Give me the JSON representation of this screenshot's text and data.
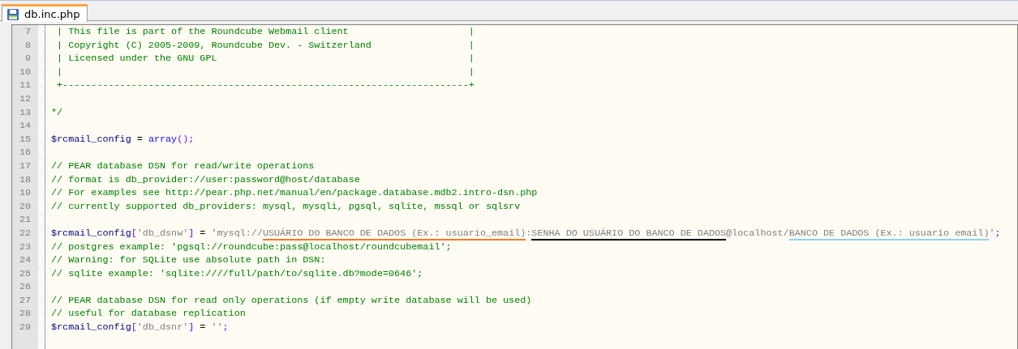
{
  "tabs": [
    {
      "label": "db.inc.php",
      "selected": true
    }
  ],
  "editor": {
    "lines": [
      {
        "number": "7",
        "tokens": [
          {
            "kind": "comment",
            "text": " | This file is part of the Roundcube Webmail client                     |"
          }
        ]
      },
      {
        "number": "8",
        "tokens": [
          {
            "kind": "comment",
            "text": " | Copyright (C) 2005-2009, Roundcube Dev. - Switzerland                 |"
          }
        ]
      },
      {
        "number": "9",
        "tokens": [
          {
            "kind": "comment",
            "text": " | Licensed under the GNU GPL                                            |"
          }
        ]
      },
      {
        "number": "10",
        "tokens": [
          {
            "kind": "comment",
            "text": " |                                                                       |"
          }
        ]
      },
      {
        "number": "11",
        "tokens": [
          {
            "kind": "comment",
            "text": " +-----------------------------------------------------------------------+"
          }
        ]
      },
      {
        "number": "12"
      },
      {
        "number": "13",
        "tokens": [
          {
            "kind": "comment",
            "text": "*/"
          }
        ]
      },
      {
        "number": "14"
      },
      {
        "number": "15",
        "tokens": [
          {
            "kind": "variable",
            "text": "$rcmail_config"
          },
          {
            "kind": "plain",
            "text": " = "
          },
          {
            "kind": "keyword",
            "text": "array"
          },
          {
            "kind": "operator",
            "text": "();"
          }
        ]
      },
      {
        "number": "16"
      },
      {
        "number": "17",
        "tokens": [
          {
            "kind": "comment",
            "text": "// PEAR database DSN for read/write operations"
          }
        ]
      },
      {
        "number": "18",
        "tokens": [
          {
            "kind": "comment",
            "text": "// format is db_provider://user:password@host/database"
          }
        ]
      },
      {
        "number": "19",
        "tokens": [
          {
            "kind": "comment",
            "text": "// For examples see http://pear.php.net/manual/en/package.database.mdb2.intro-dsn.php"
          }
        ]
      },
      {
        "number": "20",
        "tokens": [
          {
            "kind": "comment",
            "text": "// currently supported db_providers: mysql, mysqli, pgsql, sqlite, mssql or sqlsrv"
          }
        ]
      },
      {
        "number": "21"
      },
      {
        "number": "22",
        "tokens": [
          {
            "kind": "variable",
            "text": "$rcmail_config"
          },
          {
            "kind": "operator",
            "text": "["
          },
          {
            "kind": "string",
            "text": "'db_dsnw'"
          },
          {
            "kind": "operator",
            "text": "]"
          },
          {
            "kind": "plain",
            "text": " = "
          },
          {
            "kind": "string",
            "text": "'mysql://"
          },
          {
            "kind": "string",
            "text": "USUÁRIO DO BANCO DE DADOS (Ex.: usuario_email)",
            "color": "#f47a2a"
          },
          {
            "kind": "string",
            "text": ":"
          },
          {
            "kind": "string",
            "text": "SENHA DO USUÁRIO DO BANCO DE DADOS",
            "color": "#000000"
          },
          {
            "kind": "string",
            "text": "@localhost/"
          },
          {
            "kind": "string",
            "text": "BANCO DE DADOS (Ex.: usuario email)",
            "color": "#8fd3ea"
          },
          {
            "kind": "string",
            "text": "'"
          },
          {
            "kind": "operator",
            "text": ";"
          }
        ]
      },
      {
        "number": "23",
        "tokens": [
          {
            "kind": "comment",
            "text": "// postgres example: 'pgsql://roundcube:pass@localhost/roundcubemail';"
          }
        ]
      },
      {
        "number": "24",
        "tokens": [
          {
            "kind": "comment",
            "text": "// Warning: for SQLite use absolute path in DSN:"
          }
        ]
      },
      {
        "number": "25",
        "tokens": [
          {
            "kind": "comment",
            "text": "// sqlite example: 'sqlite:////full/path/to/sqlite.db?mode=0646';"
          }
        ]
      },
      {
        "number": "26"
      },
      {
        "number": "27",
        "tokens": [
          {
            "kind": "comment",
            "text": "// PEAR database DSN for read only operations (if empty write database will be used)"
          }
        ]
      },
      {
        "number": "28",
        "tokens": [
          {
            "kind": "comment",
            "text": "// useful for database replication"
          }
        ]
      },
      {
        "number": "29",
        "tokens": [
          {
            "kind": "variable",
            "text": "$rcmail_config"
          },
          {
            "kind": "operator",
            "text": "["
          },
          {
            "kind": "string",
            "text": "'db_dsnr'"
          },
          {
            "kind": "operator",
            "text": "]"
          },
          {
            "kind": "plain",
            "text": " = "
          },
          {
            "kind": "string",
            "text": "''"
          },
          {
            "kind": "operator",
            "text": ";"
          }
        ]
      }
    ]
  }
}
